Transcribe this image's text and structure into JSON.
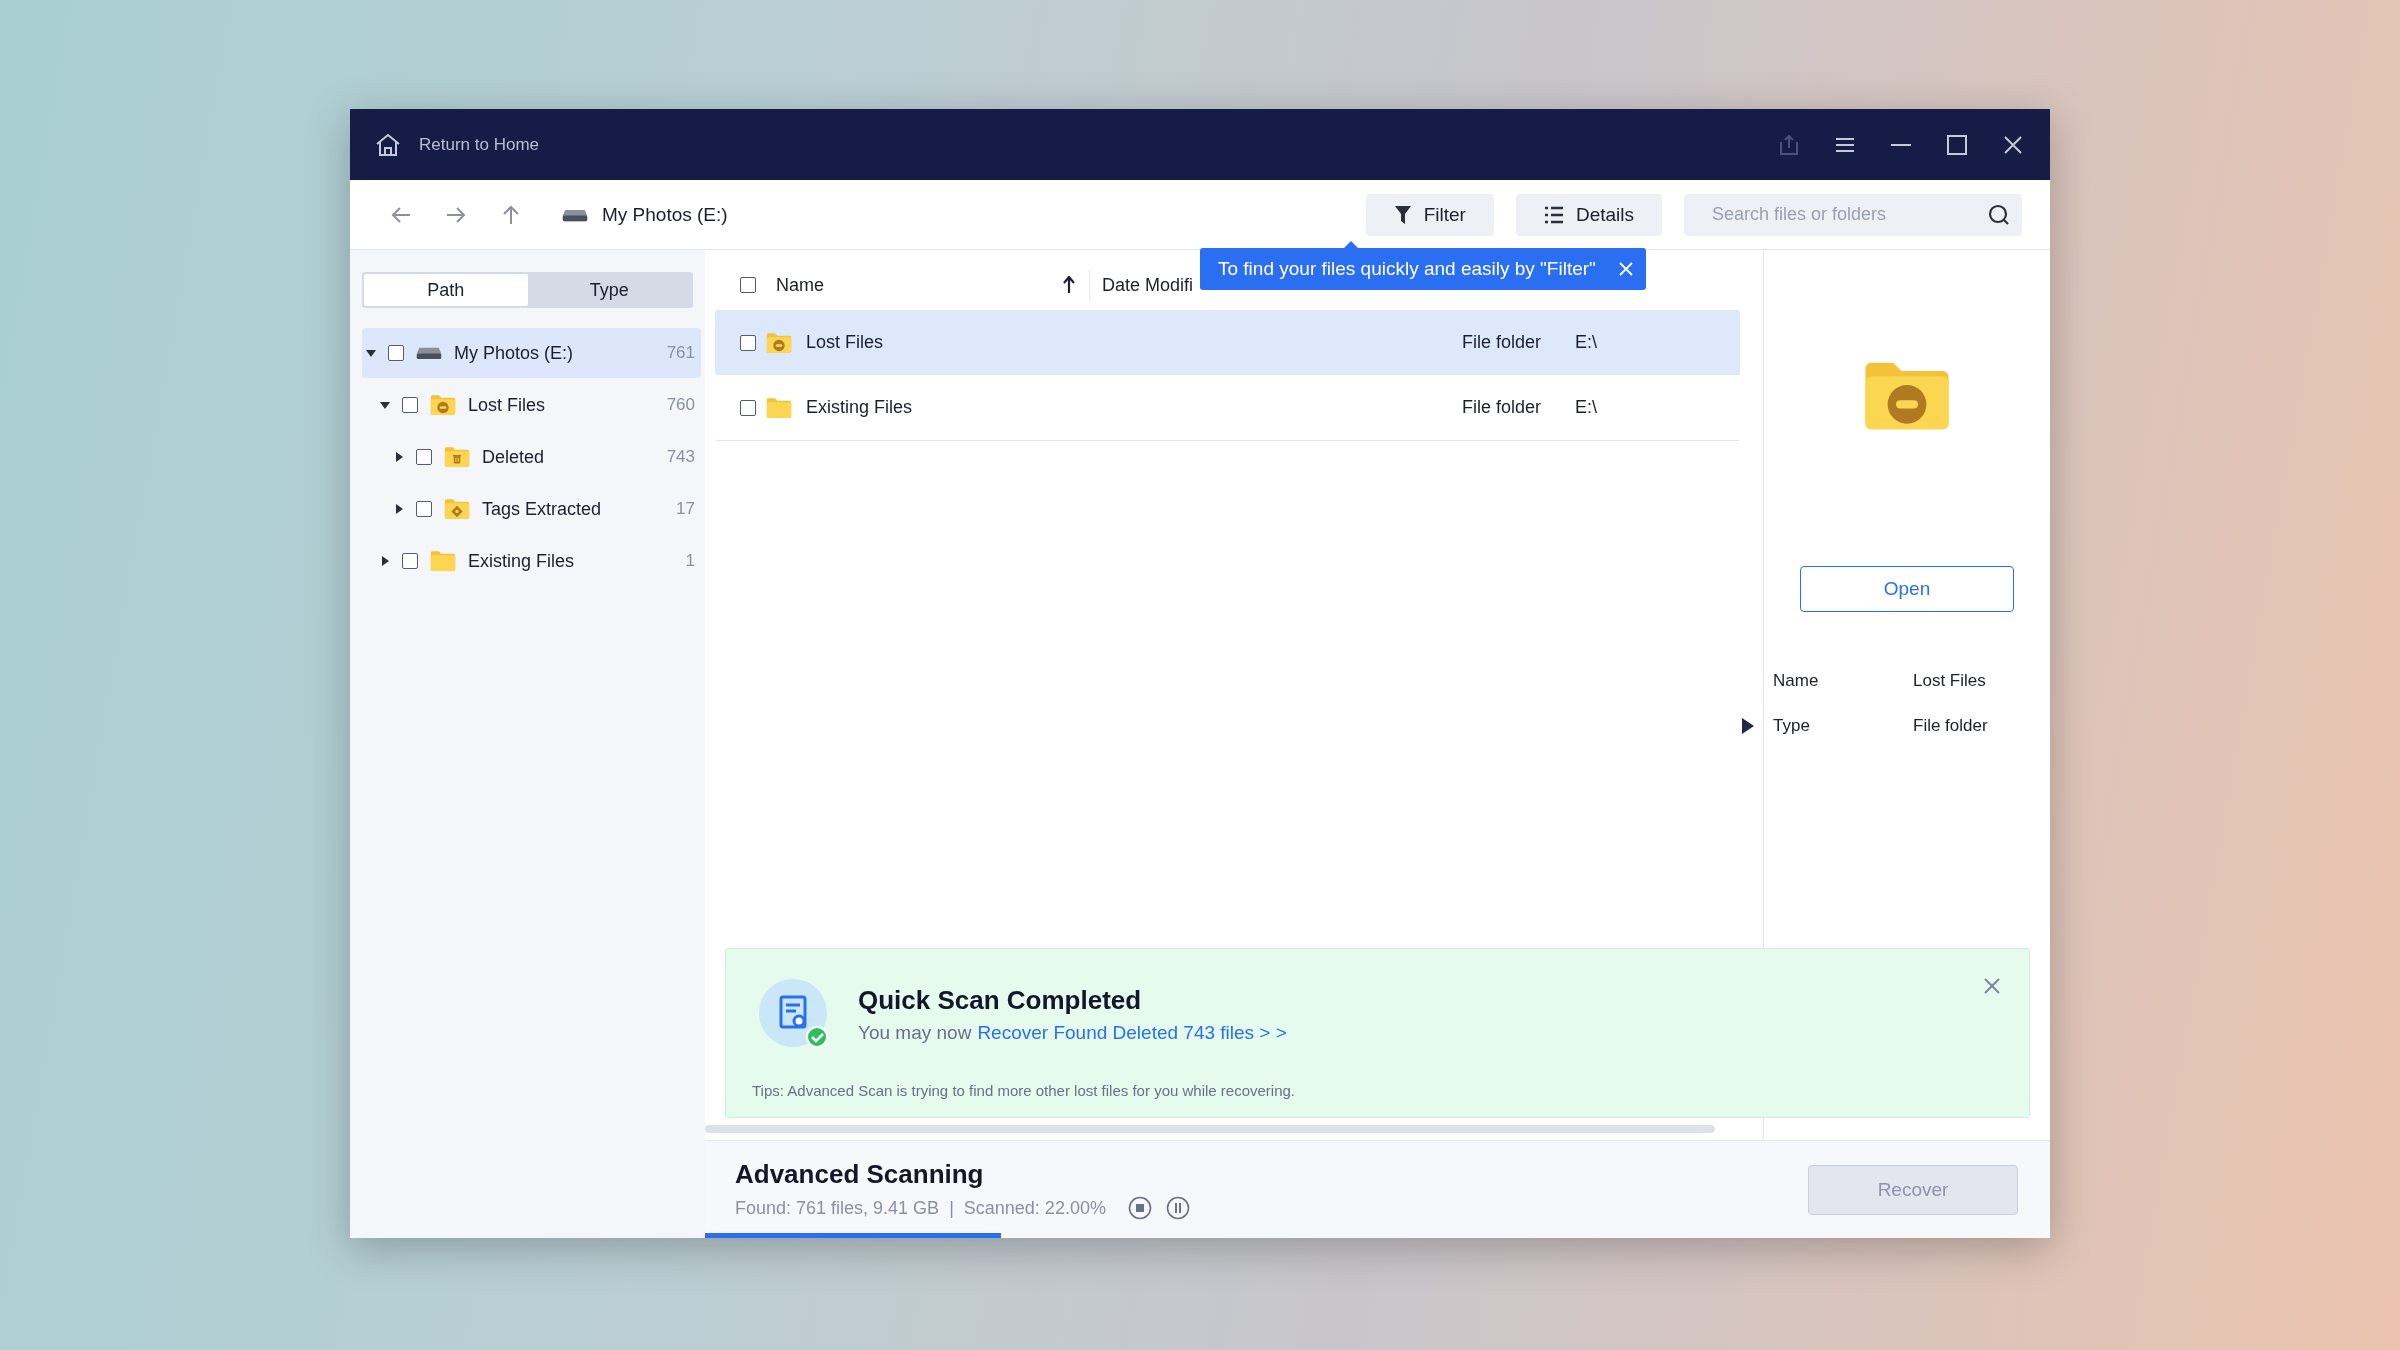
{
  "title_bar": {
    "home_label": "Return to Home"
  },
  "toolbar": {
    "location": "My Photos (E:)",
    "buttons": [
      {
        "label": "Filter",
        "kind": "filter"
      },
      {
        "label": "Details",
        "kind": "details"
      }
    ],
    "search": {
      "placeholder": "Search files or folders"
    }
  },
  "tooltip": {
    "text": "To find your files quickly and easily by \"Filter\""
  },
  "sidebar": {
    "tabs": [
      {
        "label": "Path",
        "selected": true
      },
      {
        "label": "Type",
        "selected": false
      }
    ],
    "tree": [
      {
        "label": "My Photos (E:)",
        "count": "761",
        "kind": "drive",
        "expanded": true,
        "checked": false,
        "selected": true,
        "children": [
          {
            "label": "Lost Files",
            "count": "760",
            "kind": "lost",
            "expanded": true,
            "checked": false,
            "selected": false,
            "children": [
              {
                "label": "Deleted",
                "count": "743",
                "kind": "deleted",
                "expanded": false,
                "checked": false,
                "selected": false
              },
              {
                "label": "Tags Extracted",
                "count": "17",
                "kind": "tags",
                "expanded": false,
                "checked": false,
                "selected": false
              }
            ]
          },
          {
            "label": "Existing Files",
            "count": "1",
            "kind": "folder",
            "expanded": false,
            "checked": false,
            "selected": false
          }
        ]
      }
    ]
  },
  "file_list": {
    "header_checked": false,
    "columns": [
      {
        "label": "Name",
        "sorted": true
      },
      {
        "label": "Date Modifi",
        "sorted": false
      }
    ],
    "rows": [
      {
        "name": "Lost Files",
        "kind": "lost",
        "type": "File folder",
        "path": "E:\\",
        "checked": false,
        "selected": true
      },
      {
        "name": "Existing Files",
        "kind": "folder",
        "type": "File folder",
        "path": "E:\\",
        "checked": false,
        "selected": false
      }
    ]
  },
  "preview": {
    "kind": "lost",
    "button": "Open",
    "details": [
      {
        "label": "Name",
        "value": "Lost Files",
        "current": false
      },
      {
        "label": "Type",
        "value": "File folder",
        "current": true
      }
    ]
  },
  "banner": {
    "title": "Quick Scan Completed",
    "lead": "You may now",
    "link": "Recover Found Deleted 743 files > >",
    "tips": "Tips: Advanced Scan is trying to find more other lost files for you while recovering."
  },
  "status": {
    "title": "Advanced Scanning",
    "info": "Found: 761 files, 9.41 GB  |  Scanned: 22.00%",
    "level": 0.22,
    "recover": {
      "label": "Recover",
      "disabled": true
    }
  }
}
